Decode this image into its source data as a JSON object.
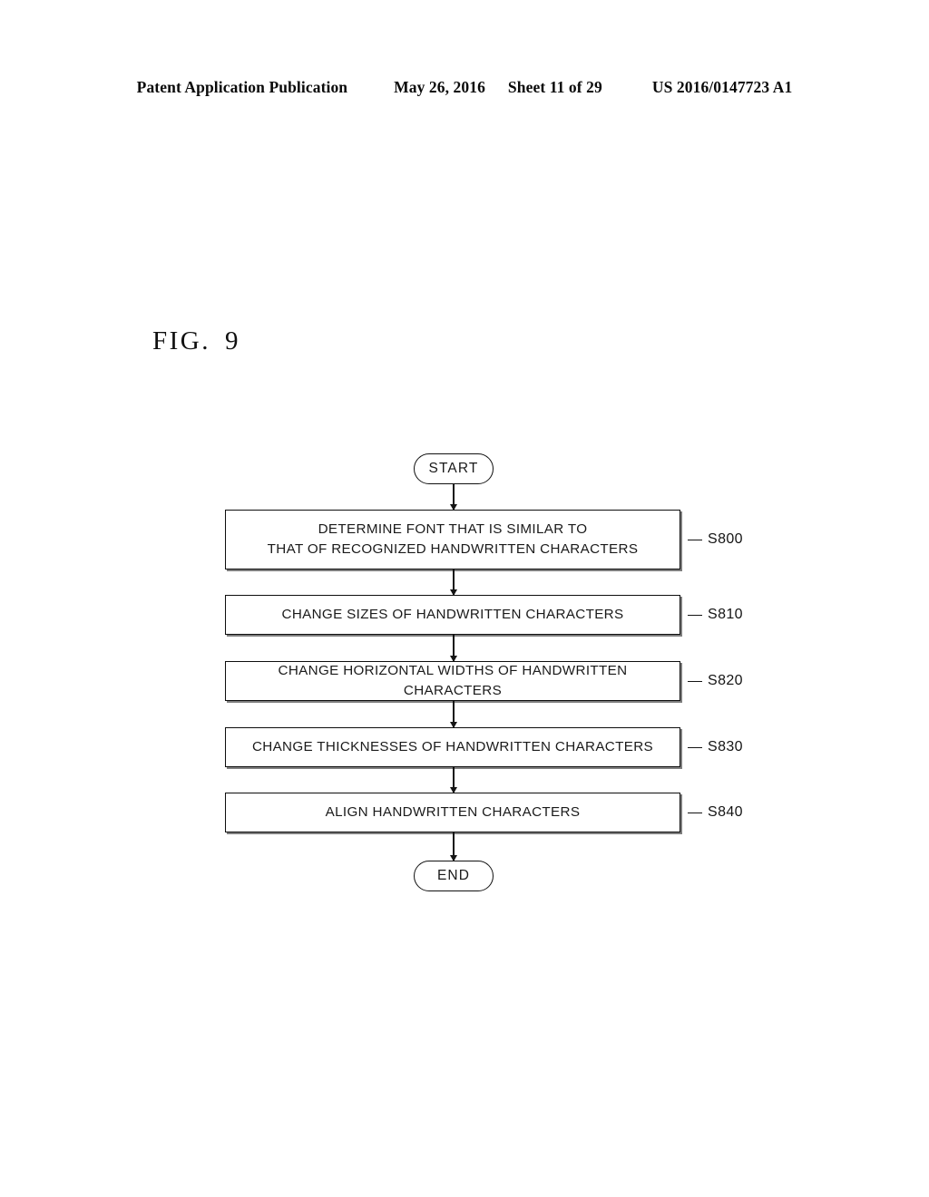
{
  "header": {
    "publication": "Patent Application Publication",
    "date": "May 26, 2016",
    "sheet": "Sheet 11 of 29",
    "patent_number": "US 2016/0147723 A1"
  },
  "figure": {
    "caption_prefix": "FIG.",
    "caption_number": "9"
  },
  "flowchart": {
    "start_label": "START",
    "end_label": "END",
    "steps": [
      {
        "id": "S800",
        "text": "DETERMINE FONT THAT IS SIMILAR TO\nTHAT OF RECOGNIZED HANDWRITTEN CHARACTERS",
        "line1": "DETERMINE FONT THAT IS SIMILAR TO",
        "line2": "THAT OF RECOGNIZED HANDWRITTEN CHARACTERS",
        "label": "S800"
      },
      {
        "id": "S810",
        "text": "CHANGE SIZES OF HANDWRITTEN CHARACTERS",
        "label": "S810"
      },
      {
        "id": "S820",
        "text": "CHANGE HORIZONTAL WIDTHS OF HANDWRITTEN CHARACTERS",
        "label": "S820"
      },
      {
        "id": "S830",
        "text": "CHANGE THICKNESSES OF HANDWRITTEN CHARACTERS",
        "label": "S830"
      },
      {
        "id": "S840",
        "text": "ALIGN HANDWRITTEN CHARACTERS",
        "label": "S840"
      }
    ]
  },
  "colors": {
    "ink": "#141414",
    "paper": "#ffffff"
  }
}
